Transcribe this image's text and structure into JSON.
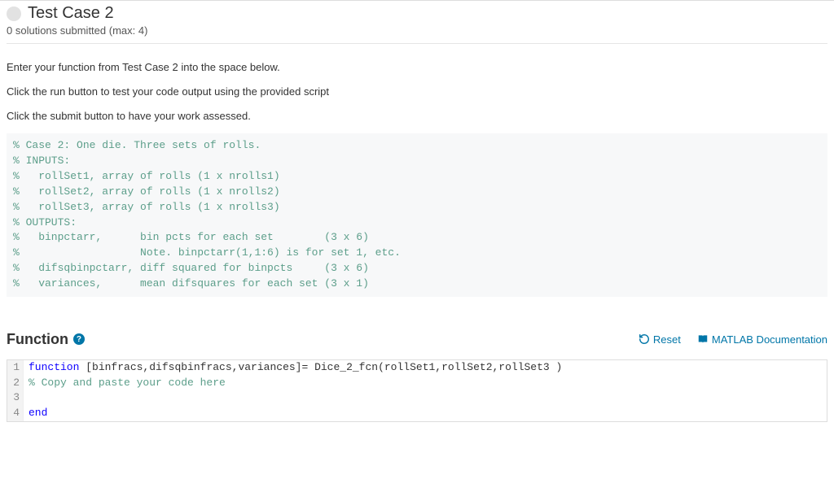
{
  "header": {
    "title": "Test Case 2",
    "subtitle": "0 solutions submitted (max: 4)"
  },
  "instructions": {
    "l1": "Enter your function from Test Case 2 into the space below.",
    "l2": "Click the run button to test your code output using the provided script",
    "l3": "Click the submit button to have your work assessed."
  },
  "spec_block": "% Case 2: One die. Three sets of rolls.\n% INPUTS:\n%   rollSet1, array of rolls (1 x nrolls1)\n%   rollSet2, array of rolls (1 x nrolls2)\n%   rollSet3, array of rolls (1 x nrolls3)\n% OUTPUTS:\n%   binpctarr,      bin pcts for each set        (3 x 6)\n%                   Note. binpctarr(1,1:6) is for set 1, etc.\n%   difsqbinpctarr, diff squared for binpcts     (3 x 6)\n%   variances,      mean difsquares for each set (3 x 1)",
  "section": {
    "title": "Function",
    "help": "?",
    "reset_label": "Reset",
    "docs_label": "MATLAB Documentation"
  },
  "editor": {
    "rows": [
      {
        "n": "1",
        "kw1": "function",
        "mid": " [binfracs,difsqbinfracs,variances]= Dice_2_fcn(rollSet1,rollSet2,rollSet3 )"
      },
      {
        "n": "2",
        "comment": "% Copy and paste your code here"
      },
      {
        "n": "3",
        "plain": ""
      },
      {
        "n": "4",
        "kw1": "end"
      }
    ]
  }
}
